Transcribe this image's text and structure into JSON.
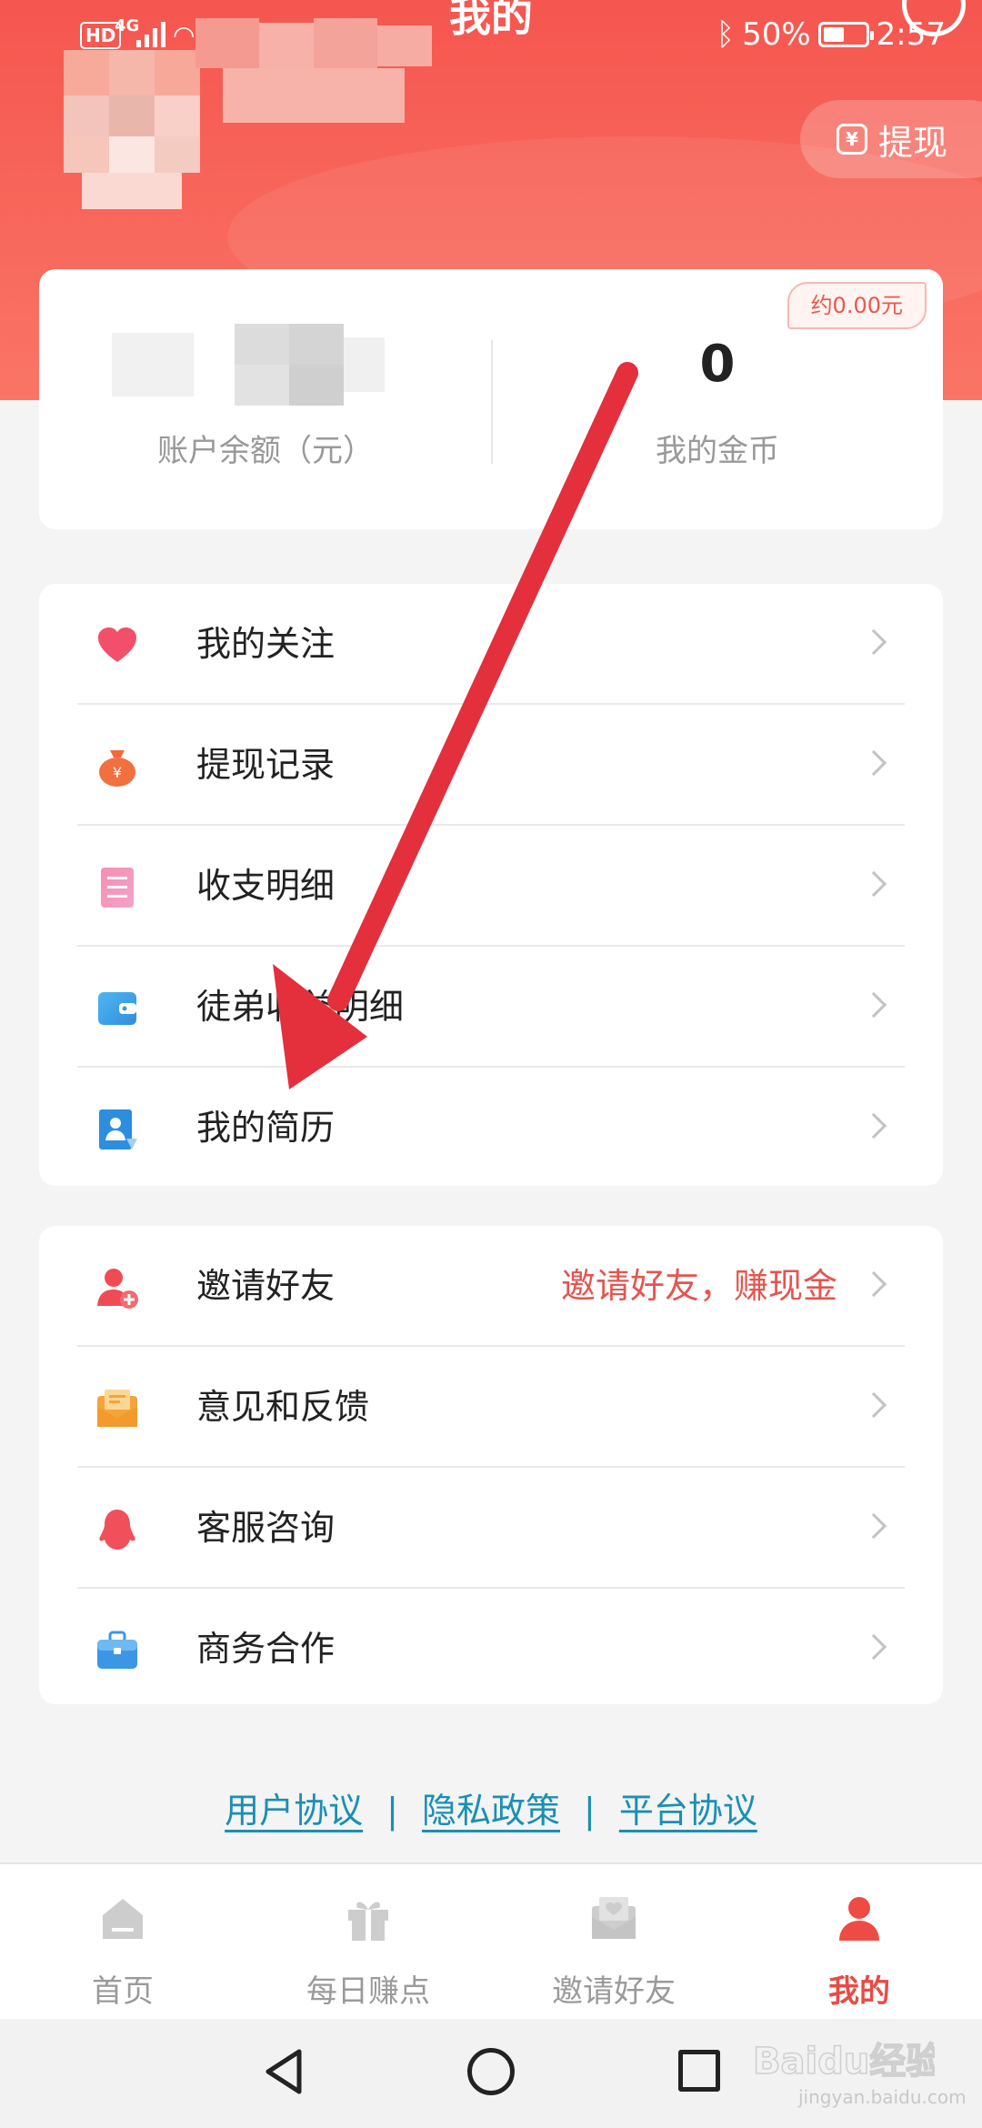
{
  "status_bar": {
    "network_hd": "HD",
    "network_type": "4G",
    "page_title": "我的",
    "battery_percent": "50%",
    "time": "2:57"
  },
  "header": {
    "withdraw_label": "提现",
    "withdraw_icon": "yen-wallet-icon"
  },
  "balance_card": {
    "balance_label": "账户余额（元）",
    "coins_value": "0",
    "coins_label": "我的金币",
    "approx_badge": "约0.00元"
  },
  "menu_group_1": [
    {
      "label": "我的关注",
      "icon": "heart-icon"
    },
    {
      "label": "提现记录",
      "icon": "money-bag-icon"
    },
    {
      "label": "收支明细",
      "icon": "list-icon"
    },
    {
      "label": "徒弟收益明细",
      "icon": "wallet-icon"
    },
    {
      "label": "我的简历",
      "icon": "resume-icon"
    }
  ],
  "menu_group_2": [
    {
      "label": "邀请好友",
      "extra": "邀请好友，赚现金",
      "icon": "add-user-icon"
    },
    {
      "label": "意见和反馈",
      "icon": "mail-icon"
    },
    {
      "label": "客服咨询",
      "icon": "penguin-icon"
    },
    {
      "label": "商务合作",
      "icon": "briefcase-icon"
    }
  ],
  "footer_links": {
    "user_agreement": "用户协议",
    "privacy_policy": "隐私政策",
    "platform_agreement": "平台协议",
    "separator": "|"
  },
  "tabbar": [
    {
      "label": "首页",
      "icon": "home-icon",
      "active": false
    },
    {
      "label": "每日赚点",
      "icon": "gift-icon",
      "active": false
    },
    {
      "label": "邀请好友",
      "icon": "invite-letter-icon",
      "active": false
    },
    {
      "label": "我的",
      "icon": "profile-icon",
      "active": true
    }
  ],
  "colors": {
    "header_red": "#f5564f",
    "accent_red": "#e74c44",
    "link_blue": "#1a8fb5",
    "arrow_red": "#e3303c"
  },
  "watermark": {
    "brand": "Baidu经验",
    "url": "jingyan.baidu.com"
  }
}
